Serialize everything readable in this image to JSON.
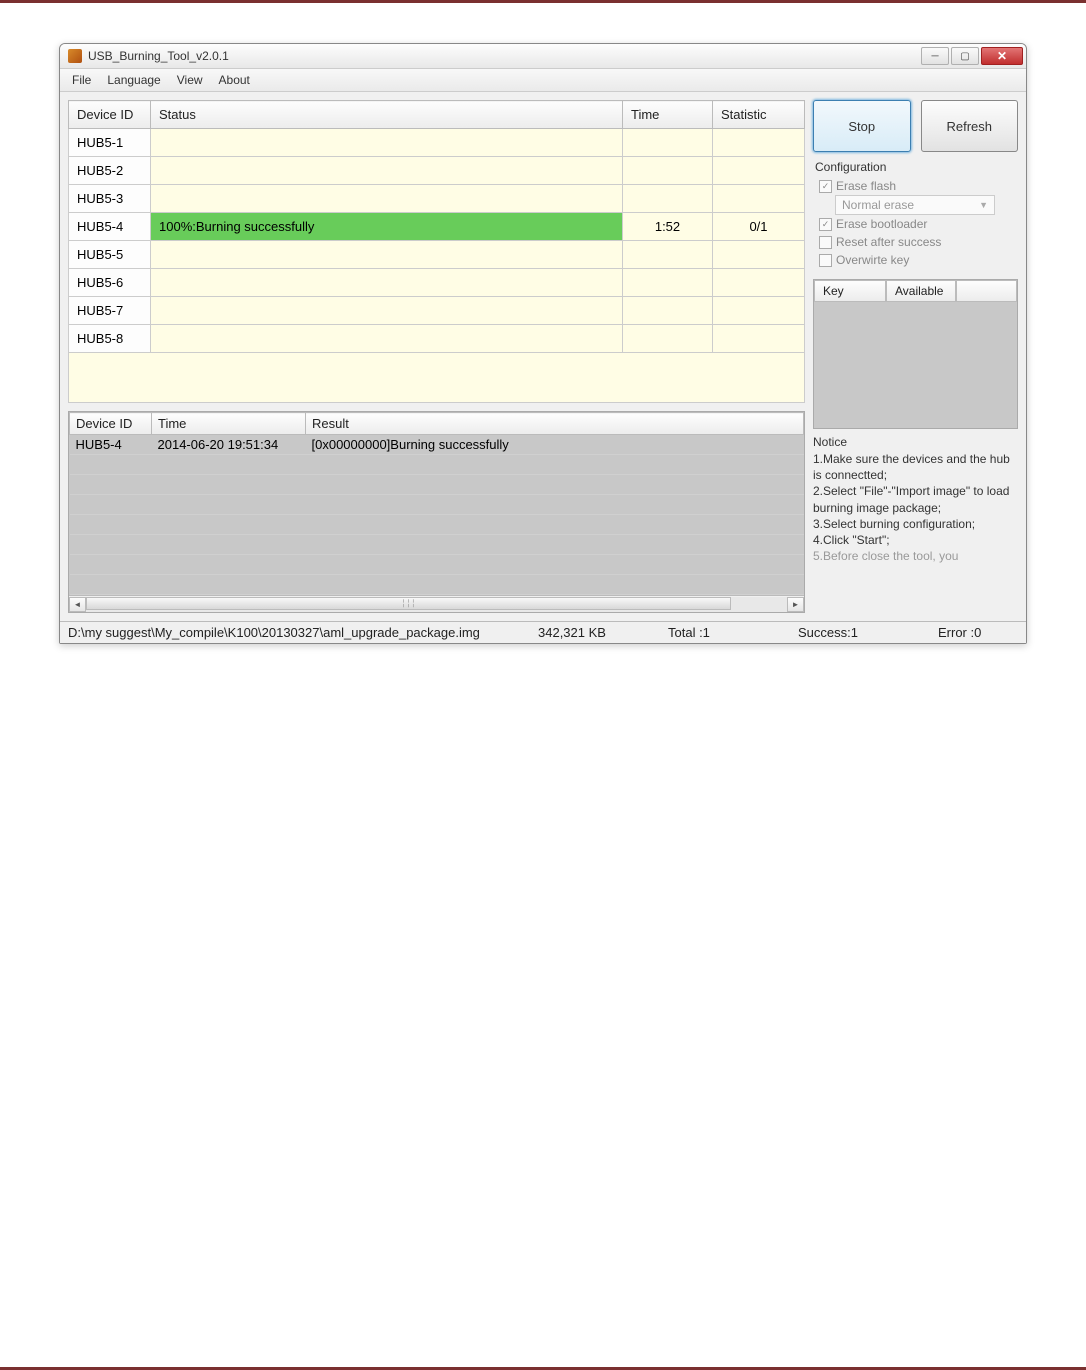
{
  "window": {
    "title": "USB_Burning_Tool_v2.0.1"
  },
  "menu": {
    "file": "File",
    "language": "Language",
    "view": "View",
    "about": "About"
  },
  "main_table": {
    "headers": {
      "device_id": "Device ID",
      "status": "Status",
      "time": "Time",
      "statistic": "Statistic"
    },
    "rows": [
      {
        "id": "HUB5-1",
        "status": "",
        "time": "",
        "stat": "",
        "success": false
      },
      {
        "id": "HUB5-2",
        "status": "",
        "time": "",
        "stat": "",
        "success": false
      },
      {
        "id": "HUB5-3",
        "status": "",
        "time": "",
        "stat": "",
        "success": false
      },
      {
        "id": "HUB5-4",
        "status": "100%:Burning successfully",
        "time": "1:52",
        "stat": "0/1",
        "success": true
      },
      {
        "id": "HUB5-5",
        "status": "",
        "time": "",
        "stat": "",
        "success": false
      },
      {
        "id": "HUB5-6",
        "status": "",
        "time": "",
        "stat": "",
        "success": false
      },
      {
        "id": "HUB5-7",
        "status": "",
        "time": "",
        "stat": "",
        "success": false
      },
      {
        "id": "HUB5-8",
        "status": "",
        "time": "",
        "stat": "",
        "success": false
      }
    ]
  },
  "log_table": {
    "headers": {
      "device_id": "Device ID",
      "time": "Time",
      "result": "Result"
    },
    "rows": [
      {
        "id": "HUB5-4",
        "time": "2014-06-20 19:51:34",
        "result": "[0x00000000]Burning successfully"
      }
    ]
  },
  "buttons": {
    "stop": "Stop",
    "refresh": "Refresh"
  },
  "config": {
    "title": "Configuration",
    "erase_flash": "Erase flash",
    "normal_erase": "Normal erase",
    "erase_bootloader": "Erase bootloader",
    "reset_after_success": "Reset after success",
    "overwrite_key": "Overwirte key"
  },
  "key_panel": {
    "key": "Key",
    "available": "Available"
  },
  "notice": {
    "title": "Notice",
    "line1": "1.Make sure the devices and the hub is connectted;",
    "line2": "2.Select \"File\"-\"Import image\" to load burning image package;",
    "line3": "3.Select burning configuration;",
    "line4": "4.Click \"Start\";",
    "line5": "5.Before close the tool, you"
  },
  "status_bar": {
    "path": "D:\\my suggest\\My_compile\\K100\\20130327\\aml_upgrade_package.img",
    "size": "342,321 KB",
    "total": "Total :1",
    "success": "Success:1",
    "error": "Error :0"
  }
}
